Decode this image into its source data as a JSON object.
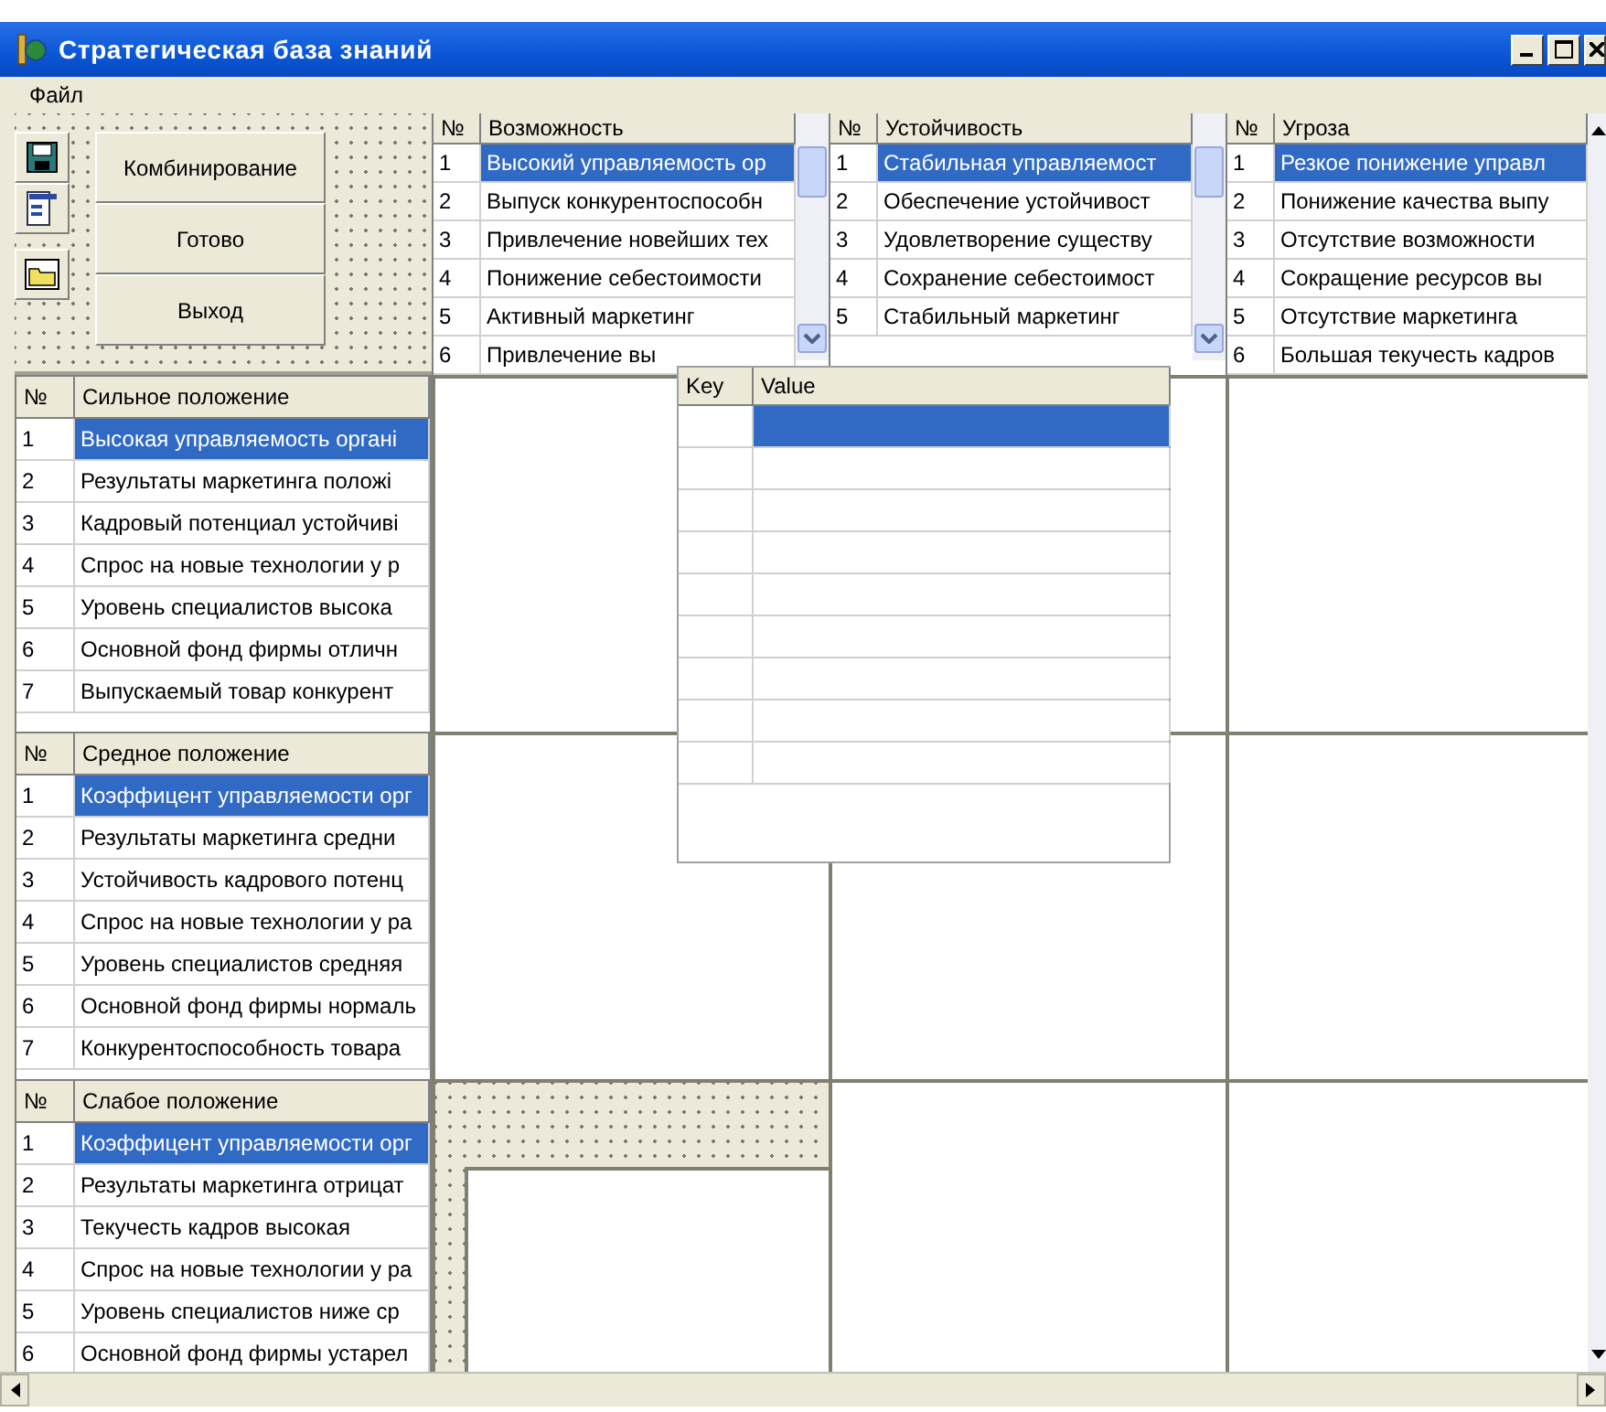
{
  "window": {
    "title": "Стратегическая база знаний"
  },
  "menu": [
    "Файл"
  ],
  "buttons": [
    "Комбинирование",
    "Готово",
    "Выход"
  ],
  "top_tables": [
    {
      "number_header": "№",
      "header": "Возможность",
      "rows": [
        {
          "n": "1",
          "text": "Высокий управляемость ор",
          "selected": true
        },
        {
          "n": "2",
          "text": "Выпуск конкурентоспособн",
          "selected": false
        },
        {
          "n": "3",
          "text": "Привлечение новейших тех",
          "selected": false
        },
        {
          "n": "4",
          "text": "Понижение себестоимости",
          "selected": false
        },
        {
          "n": "5",
          "text": "Активный маркетинг",
          "selected": false
        },
        {
          "n": "6",
          "text": "Привлечение вы",
          "selected": false
        }
      ]
    },
    {
      "number_header": "№",
      "header": "Устойчивость",
      "rows": [
        {
          "n": "1",
          "text": "Стабильная управляемост",
          "selected": true
        },
        {
          "n": "2",
          "text": "Обеспечение устойчивост",
          "selected": false
        },
        {
          "n": "3",
          "text": "Удовлетворение существу",
          "selected": false
        },
        {
          "n": "4",
          "text": "Сохранение себестоимост",
          "selected": false
        },
        {
          "n": "5",
          "text": "Стабильный маркетинг",
          "selected": false
        }
      ]
    },
    {
      "number_header": "№",
      "header": "Угроза",
      "rows": [
        {
          "n": "1",
          "text": "Резкое понижение управл",
          "selected": true
        },
        {
          "n": "2",
          "text": "Понижение качества выпу",
          "selected": false
        },
        {
          "n": "3",
          "text": "Отсутствие возможности",
          "selected": false
        },
        {
          "n": "4",
          "text": "Сокращение ресурсов вы",
          "selected": false
        },
        {
          "n": "5",
          "text": "Отсутствие маркетинга",
          "selected": false
        },
        {
          "n": "6",
          "text": "Большая текучесть кадров",
          "selected": false
        }
      ]
    }
  ],
  "side_tables": [
    {
      "number_header": "№",
      "header": "Сильное положение",
      "rows": [
        {
          "n": "1",
          "text": "Высокая управляемость органі",
          "selected": true
        },
        {
          "n": "2",
          "text": "Результаты маркетинга положі",
          "selected": false
        },
        {
          "n": "3",
          "text": "Кадровый потенциал устойчиві",
          "selected": false
        },
        {
          "n": "4",
          "text": "Спрос на новые технологии у р",
          "selected": false
        },
        {
          "n": "5",
          "text": "Уровень специалистов высока",
          "selected": false
        },
        {
          "n": "6",
          "text": "Основной фонд фирмы отличн",
          "selected": false
        },
        {
          "n": "7",
          "text": "Выпускаемый товар конкурент",
          "selected": false
        }
      ]
    },
    {
      "number_header": "№",
      "header": "Средное положение",
      "rows": [
        {
          "n": "1",
          "text": "Коэффицент управляемости орг",
          "selected": true
        },
        {
          "n": "2",
          "text": "Результаты маркетинга средни",
          "selected": false
        },
        {
          "n": "3",
          "text": "Устойчивость кадрового потенц",
          "selected": false
        },
        {
          "n": "4",
          "text": "Спрос на новые технологии у ра",
          "selected": false
        },
        {
          "n": "5",
          "text": "Уровень специалистов средняя",
          "selected": false
        },
        {
          "n": "6",
          "text": "Основной фонд фирмы нормаль",
          "selected": false
        },
        {
          "n": "7",
          "text": "Конкурентоспособность товара",
          "selected": false
        }
      ]
    },
    {
      "number_header": "№",
      "header": "Слабое положение",
      "rows": [
        {
          "n": "1",
          "text": "Коэффицент управляемости орг",
          "selected": true
        },
        {
          "n": "2",
          "text": "Результаты маркетинга отрицат",
          "selected": false
        },
        {
          "n": "3",
          "text": "Текучесть кадров высокая",
          "selected": false
        },
        {
          "n": "4",
          "text": "Спрос на новые технологии у ра",
          "selected": false
        },
        {
          "n": "5",
          "text": "Уровень специалистов ниже ср",
          "selected": false
        },
        {
          "n": "6",
          "text": "Основной фонд фирмы устарел",
          "selected": false
        }
      ]
    }
  ],
  "key_value_grid": {
    "columns": [
      "Key",
      "Value"
    ],
    "rows": [
      {
        "selected": true
      },
      {
        "selected": false
      },
      {
        "selected": false
      },
      {
        "selected": false
      },
      {
        "selected": false
      },
      {
        "selected": false
      },
      {
        "selected": false
      },
      {
        "selected": false
      },
      {
        "selected": false
      }
    ]
  }
}
